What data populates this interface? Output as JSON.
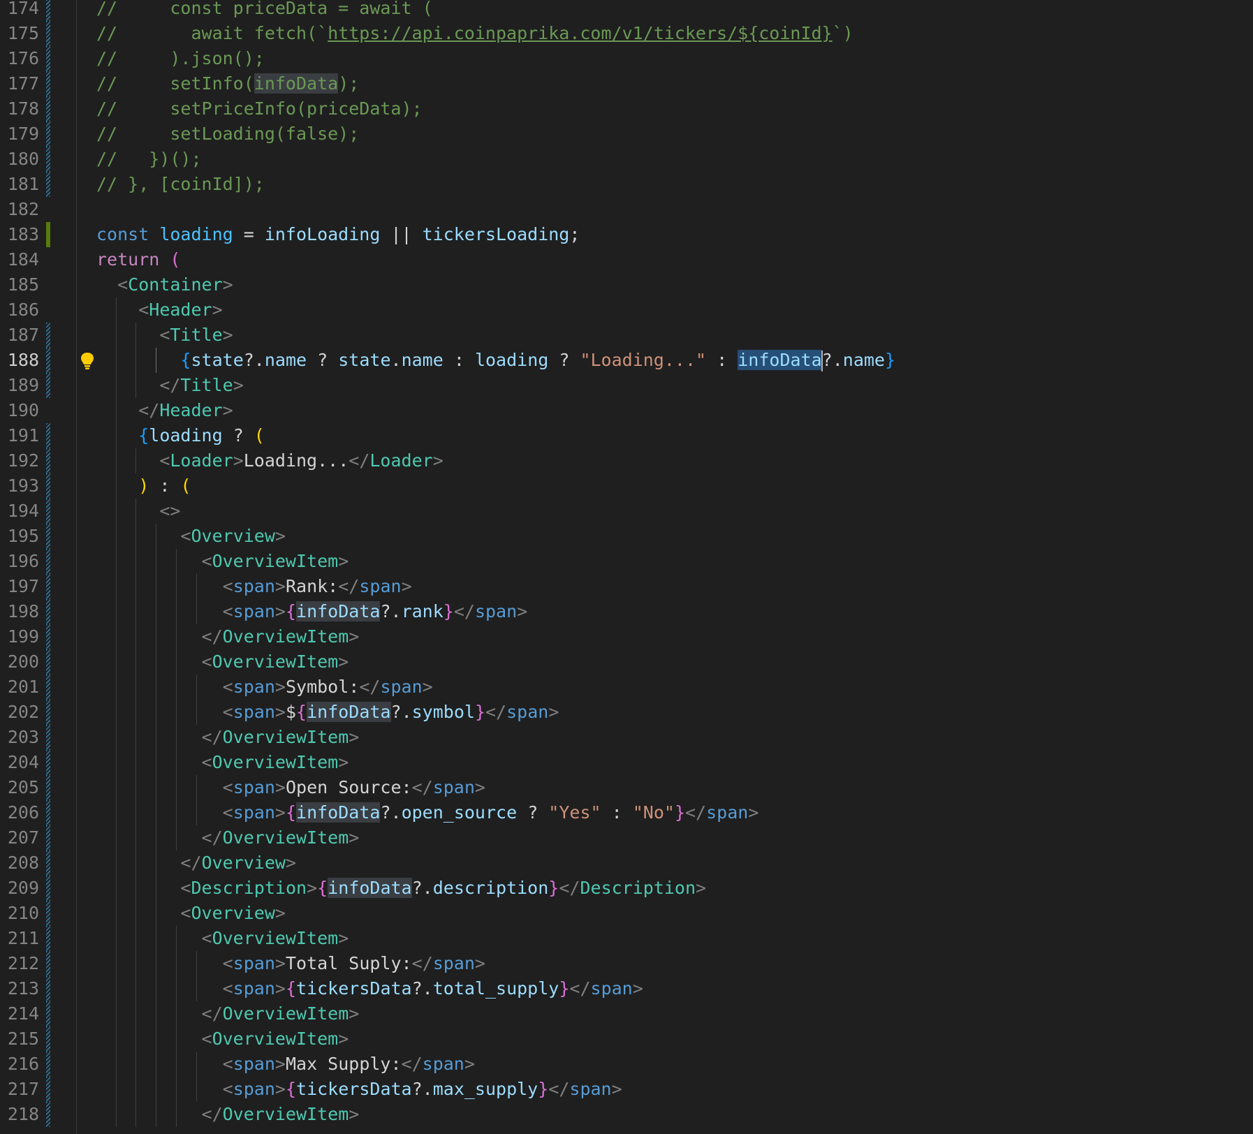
{
  "editor": {
    "first_line": 174,
    "active_line": 188,
    "lines": [
      {
        "n": "174",
        "g": "mod",
        "t": [
          [
            "cm",
            "//     const priceData = await ("
          ]
        ]
      },
      {
        "n": "175",
        "g": "mod",
        "t": [
          [
            "cm",
            "//       await fetch(`"
          ],
          [
            "cm-url",
            "https://api.coinpaprika.com/v1/tickers/${coinId}"
          ],
          [
            "cm",
            "`)"
          ]
        ]
      },
      {
        "n": "176",
        "g": "mod",
        "t": [
          [
            "cm",
            "//     ).json();"
          ]
        ]
      },
      {
        "n": "177",
        "g": "mod",
        "t": [
          [
            "cm",
            "//     setInfo("
          ],
          [
            "cm hl",
            "infoData"
          ],
          [
            "cm",
            ");"
          ]
        ]
      },
      {
        "n": "178",
        "g": "mod",
        "t": [
          [
            "cm",
            "//     setPriceInfo(priceData);"
          ]
        ]
      },
      {
        "n": "179",
        "g": "mod",
        "t": [
          [
            "cm",
            "//     setLoading(false);"
          ]
        ]
      },
      {
        "n": "180",
        "g": "mod",
        "t": [
          [
            "cm",
            "//   })();"
          ]
        ]
      },
      {
        "n": "181",
        "g": "mod",
        "t": [
          [
            "cm",
            "// }, [coinId]);"
          ]
        ]
      },
      {
        "n": "182",
        "t": []
      },
      {
        "n": "183",
        "g": "add",
        "t": [
          [
            "kw",
            "const "
          ],
          [
            "cst",
            "loading"
          ],
          [
            "op",
            " = "
          ],
          [
            "var",
            "infoLoading"
          ],
          [
            "op",
            " || "
          ],
          [
            "var",
            "tickersLoading"
          ],
          [
            "op",
            ";"
          ]
        ]
      },
      {
        "n": "184",
        "t": [
          [
            "ctl",
            "return "
          ],
          [
            "b2",
            "("
          ]
        ]
      },
      {
        "n": "185",
        "t": [
          [
            "txt",
            "  "
          ],
          [
            "punc",
            "<"
          ],
          [
            "tag",
            "Container"
          ],
          [
            "punc",
            ">"
          ]
        ]
      },
      {
        "n": "186",
        "t": [
          [
            "txt",
            "    "
          ],
          [
            "punc",
            "<"
          ],
          [
            "tag",
            "Header"
          ],
          [
            "punc",
            ">"
          ]
        ]
      },
      {
        "n": "187",
        "g": "mod",
        "t": [
          [
            "txt",
            "      "
          ],
          [
            "punc",
            "<"
          ],
          [
            "tag",
            "Title"
          ],
          [
            "punc",
            ">"
          ]
        ]
      },
      {
        "n": "188",
        "g": "mod",
        "bulb": true,
        "t": [
          [
            "txt",
            "        "
          ],
          [
            "b3",
            "{"
          ],
          [
            "var",
            "state"
          ],
          [
            "op",
            "?."
          ],
          [
            "var",
            "name"
          ],
          [
            "op",
            " ? "
          ],
          [
            "var",
            "state"
          ],
          [
            "op",
            "."
          ],
          [
            "var",
            "name"
          ],
          [
            "op",
            " : "
          ],
          [
            "var",
            "loading"
          ],
          [
            "op",
            " ? "
          ],
          [
            "str",
            "\"Loading...\""
          ],
          [
            "op",
            " : "
          ],
          [
            "var hl-sel",
            "infoData"
          ],
          [
            "caret",
            ""
          ],
          [
            "op",
            "?."
          ],
          [
            "var",
            "name"
          ],
          [
            "b3",
            "}"
          ]
        ]
      },
      {
        "n": "189",
        "g": "mod",
        "t": [
          [
            "txt",
            "      "
          ],
          [
            "punc",
            "</"
          ],
          [
            "tag",
            "Title"
          ],
          [
            "punc",
            ">"
          ]
        ]
      },
      {
        "n": "190",
        "t": [
          [
            "txt",
            "    "
          ],
          [
            "punc",
            "</"
          ],
          [
            "tag",
            "Header"
          ],
          [
            "punc",
            ">"
          ]
        ]
      },
      {
        "n": "191",
        "g": "mod",
        "t": [
          [
            "txt",
            "    "
          ],
          [
            "b3",
            "{"
          ],
          [
            "var",
            "loading"
          ],
          [
            "op",
            " ? "
          ],
          [
            "b1",
            "("
          ]
        ]
      },
      {
        "n": "192",
        "g": "mod",
        "t": [
          [
            "txt",
            "      "
          ],
          [
            "punc",
            "<"
          ],
          [
            "tag",
            "Loader"
          ],
          [
            "punc",
            ">"
          ],
          [
            "txt",
            "Loading..."
          ],
          [
            "punc",
            "</"
          ],
          [
            "tag",
            "Loader"
          ],
          [
            "punc",
            ">"
          ]
        ]
      },
      {
        "n": "193",
        "g": "mod",
        "t": [
          [
            "txt",
            "    "
          ],
          [
            "b1",
            ")"
          ],
          [
            "op",
            " : "
          ],
          [
            "b1",
            "("
          ]
        ]
      },
      {
        "n": "194",
        "g": "mod",
        "t": [
          [
            "txt",
            "      "
          ],
          [
            "punc",
            "<>"
          ]
        ]
      },
      {
        "n": "195",
        "g": "mod",
        "t": [
          [
            "txt",
            "        "
          ],
          [
            "punc",
            "<"
          ],
          [
            "tag",
            "Overview"
          ],
          [
            "punc",
            ">"
          ]
        ]
      },
      {
        "n": "196",
        "g": "mod",
        "t": [
          [
            "txt",
            "          "
          ],
          [
            "punc",
            "<"
          ],
          [
            "tag",
            "OverviewItem"
          ],
          [
            "punc",
            ">"
          ]
        ]
      },
      {
        "n": "197",
        "g": "mod",
        "t": [
          [
            "txt",
            "            "
          ],
          [
            "punc",
            "<"
          ],
          [
            "htm",
            "span"
          ],
          [
            "punc",
            ">"
          ],
          [
            "txt",
            "Rank:"
          ],
          [
            "punc",
            "</"
          ],
          [
            "htm",
            "span"
          ],
          [
            "punc",
            ">"
          ]
        ]
      },
      {
        "n": "198",
        "g": "mod",
        "t": [
          [
            "txt",
            "            "
          ],
          [
            "punc",
            "<"
          ],
          [
            "htm",
            "span"
          ],
          [
            "punc",
            ">"
          ],
          [
            "b2",
            "{"
          ],
          [
            "var hl",
            "infoData"
          ],
          [
            "op",
            "?."
          ],
          [
            "var",
            "rank"
          ],
          [
            "b2",
            "}"
          ],
          [
            "punc",
            "</"
          ],
          [
            "htm",
            "span"
          ],
          [
            "punc",
            ">"
          ]
        ]
      },
      {
        "n": "199",
        "g": "mod",
        "t": [
          [
            "txt",
            "          "
          ],
          [
            "punc",
            "</"
          ],
          [
            "tag",
            "OverviewItem"
          ],
          [
            "punc",
            ">"
          ]
        ]
      },
      {
        "n": "200",
        "g": "mod",
        "t": [
          [
            "txt",
            "          "
          ],
          [
            "punc",
            "<"
          ],
          [
            "tag",
            "OverviewItem"
          ],
          [
            "punc",
            ">"
          ]
        ]
      },
      {
        "n": "201",
        "g": "mod",
        "t": [
          [
            "txt",
            "            "
          ],
          [
            "punc",
            "<"
          ],
          [
            "htm",
            "span"
          ],
          [
            "punc",
            ">"
          ],
          [
            "txt",
            "Symbol:"
          ],
          [
            "punc",
            "</"
          ],
          [
            "htm",
            "span"
          ],
          [
            "punc",
            ">"
          ]
        ]
      },
      {
        "n": "202",
        "g": "mod",
        "t": [
          [
            "txt",
            "            "
          ],
          [
            "punc",
            "<"
          ],
          [
            "htm",
            "span"
          ],
          [
            "punc",
            ">"
          ],
          [
            "txt",
            "$"
          ],
          [
            "b2",
            "{"
          ],
          [
            "var hl",
            "infoData"
          ],
          [
            "op",
            "?."
          ],
          [
            "var",
            "symbol"
          ],
          [
            "b2",
            "}"
          ],
          [
            "punc",
            "</"
          ],
          [
            "htm",
            "span"
          ],
          [
            "punc",
            ">"
          ]
        ]
      },
      {
        "n": "203",
        "g": "mod",
        "t": [
          [
            "txt",
            "          "
          ],
          [
            "punc",
            "</"
          ],
          [
            "tag",
            "OverviewItem"
          ],
          [
            "punc",
            ">"
          ]
        ]
      },
      {
        "n": "204",
        "g": "mod",
        "t": [
          [
            "txt",
            "          "
          ],
          [
            "punc",
            "<"
          ],
          [
            "tag",
            "OverviewItem"
          ],
          [
            "punc",
            ">"
          ]
        ]
      },
      {
        "n": "205",
        "g": "mod",
        "t": [
          [
            "txt",
            "            "
          ],
          [
            "punc",
            "<"
          ],
          [
            "htm",
            "span"
          ],
          [
            "punc",
            ">"
          ],
          [
            "txt",
            "Open Source:"
          ],
          [
            "punc",
            "</"
          ],
          [
            "htm",
            "span"
          ],
          [
            "punc",
            ">"
          ]
        ]
      },
      {
        "n": "206",
        "g": "mod",
        "t": [
          [
            "txt",
            "            "
          ],
          [
            "punc",
            "<"
          ],
          [
            "htm",
            "span"
          ],
          [
            "punc",
            ">"
          ],
          [
            "b2",
            "{"
          ],
          [
            "var hl",
            "infoData"
          ],
          [
            "op",
            "?."
          ],
          [
            "var",
            "open_source"
          ],
          [
            "op",
            " ? "
          ],
          [
            "str",
            "\"Yes\""
          ],
          [
            "op",
            " : "
          ],
          [
            "str",
            "\"No\""
          ],
          [
            "b2",
            "}"
          ],
          [
            "punc",
            "</"
          ],
          [
            "htm",
            "span"
          ],
          [
            "punc",
            ">"
          ]
        ]
      },
      {
        "n": "207",
        "g": "mod",
        "t": [
          [
            "txt",
            "          "
          ],
          [
            "punc",
            "</"
          ],
          [
            "tag",
            "OverviewItem"
          ],
          [
            "punc",
            ">"
          ]
        ]
      },
      {
        "n": "208",
        "g": "mod",
        "t": [
          [
            "txt",
            "        "
          ],
          [
            "punc",
            "</"
          ],
          [
            "tag",
            "Overview"
          ],
          [
            "punc",
            ">"
          ]
        ]
      },
      {
        "n": "209",
        "g": "mod",
        "t": [
          [
            "txt",
            "        "
          ],
          [
            "punc",
            "<"
          ],
          [
            "tag",
            "Description"
          ],
          [
            "punc",
            ">"
          ],
          [
            "b2",
            "{"
          ],
          [
            "var hl",
            "infoData"
          ],
          [
            "op",
            "?."
          ],
          [
            "var",
            "description"
          ],
          [
            "b2",
            "}"
          ],
          [
            "punc",
            "</"
          ],
          [
            "tag",
            "Description"
          ],
          [
            "punc",
            ">"
          ]
        ]
      },
      {
        "n": "210",
        "g": "mod",
        "t": [
          [
            "txt",
            "        "
          ],
          [
            "punc",
            "<"
          ],
          [
            "tag",
            "Overview"
          ],
          [
            "punc",
            ">"
          ]
        ]
      },
      {
        "n": "211",
        "g": "mod",
        "t": [
          [
            "txt",
            "          "
          ],
          [
            "punc",
            "<"
          ],
          [
            "tag",
            "OverviewItem"
          ],
          [
            "punc",
            ">"
          ]
        ]
      },
      {
        "n": "212",
        "g": "mod",
        "t": [
          [
            "txt",
            "            "
          ],
          [
            "punc",
            "<"
          ],
          [
            "htm",
            "span"
          ],
          [
            "punc",
            ">"
          ],
          [
            "txt",
            "Total Suply:"
          ],
          [
            "punc",
            "</"
          ],
          [
            "htm",
            "span"
          ],
          [
            "punc",
            ">"
          ]
        ]
      },
      {
        "n": "213",
        "g": "mod",
        "t": [
          [
            "txt",
            "            "
          ],
          [
            "punc",
            "<"
          ],
          [
            "htm",
            "span"
          ],
          [
            "punc",
            ">"
          ],
          [
            "b2",
            "{"
          ],
          [
            "var",
            "tickersData"
          ],
          [
            "op",
            "?."
          ],
          [
            "var",
            "total_supply"
          ],
          [
            "b2",
            "}"
          ],
          [
            "punc",
            "</"
          ],
          [
            "htm",
            "span"
          ],
          [
            "punc",
            ">"
          ]
        ]
      },
      {
        "n": "214",
        "g": "mod",
        "t": [
          [
            "txt",
            "          "
          ],
          [
            "punc",
            "</"
          ],
          [
            "tag",
            "OverviewItem"
          ],
          [
            "punc",
            ">"
          ]
        ]
      },
      {
        "n": "215",
        "g": "mod",
        "t": [
          [
            "txt",
            "          "
          ],
          [
            "punc",
            "<"
          ],
          [
            "tag",
            "OverviewItem"
          ],
          [
            "punc",
            ">"
          ]
        ]
      },
      {
        "n": "216",
        "g": "mod",
        "t": [
          [
            "txt",
            "            "
          ],
          [
            "punc",
            "<"
          ],
          [
            "htm",
            "span"
          ],
          [
            "punc",
            ">"
          ],
          [
            "txt",
            "Max Supply:"
          ],
          [
            "punc",
            "</"
          ],
          [
            "htm",
            "span"
          ],
          [
            "punc",
            ">"
          ]
        ]
      },
      {
        "n": "217",
        "g": "mod",
        "t": [
          [
            "txt",
            "            "
          ],
          [
            "punc",
            "<"
          ],
          [
            "htm",
            "span"
          ],
          [
            "punc",
            ">"
          ],
          [
            "b2",
            "{"
          ],
          [
            "var",
            "tickersData"
          ],
          [
            "op",
            "?."
          ],
          [
            "var",
            "max_supply"
          ],
          [
            "b2",
            "}"
          ],
          [
            "punc",
            "</"
          ],
          [
            "htm",
            "span"
          ],
          [
            "punc",
            ">"
          ]
        ]
      },
      {
        "n": "218",
        "g": "mod",
        "t": [
          [
            "txt",
            "          "
          ],
          [
            "punc",
            "</"
          ],
          [
            "tag",
            "OverviewItem"
          ],
          [
            "punc",
            ">"
          ]
        ]
      }
    ]
  },
  "colors": {
    "background": "#1f1f1f",
    "comment": "#6a9955",
    "keyword": "#569cd6",
    "control": "#c586c0",
    "variable": "#9cdcfe",
    "string": "#ce9178",
    "component": "#4ec9b0",
    "gutter_modified": "#2d6a8c",
    "gutter_added": "#587c0c"
  },
  "icons": {
    "code_action": "lightbulb-icon"
  }
}
